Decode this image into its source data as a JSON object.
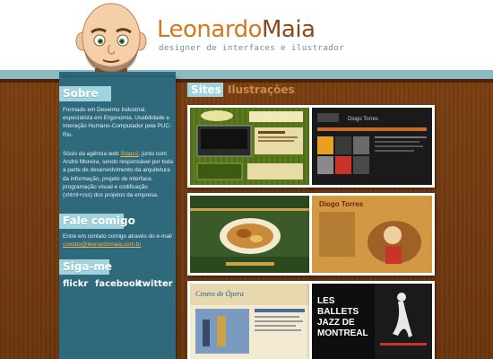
{
  "header": {
    "logo_first": "Leonardo",
    "logo_last": "Maia",
    "tagline": "designer de interfaces e ilustrador"
  },
  "sobre": {
    "heading": "Sobre",
    "para1": "Formado em Desenho Industrial, especialista em Ergonomia, Usabilidade e Interação Humano-Computador pela PUC-Rio.",
    "para2_before": "Sócio da agência web ",
    "para2_link": "Stage2",
    "para2_after": ", junto com André Moreira, sendo responsável por toda a parte de desenvolvimento da arquitetura da informação, projeto de interface, programação visual e codificação (xhtml+css) dos projetos da empresa."
  },
  "fale": {
    "heading": "Fale comigo",
    "text": "Entre em contato comigo através do e-mail",
    "email": "contato@leonardomaia.com.br"
  },
  "siga": {
    "heading": "Siga-me",
    "links": [
      "flickr",
      "facebook",
      "twitter"
    ]
  },
  "tabs": {
    "sites": "Sites",
    "ilustracoes": "Ilustrações"
  },
  "thumbs": {
    "t2_name": "Diogo Torres",
    "t4_name": "Diogo Torres",
    "t5_title": "Centro de Ópera",
    "t6_line1": "LES",
    "t6_line2": "BALLETS",
    "t6_line3": "JAZZ DE",
    "t6_line4": "MONTREAL"
  },
  "colors": {
    "accent_orange": "#d3781e",
    "sidebar_teal": "#2f6a7c",
    "heading_light_teal": "#9fd3dd",
    "background_brown": "#6e3810"
  }
}
